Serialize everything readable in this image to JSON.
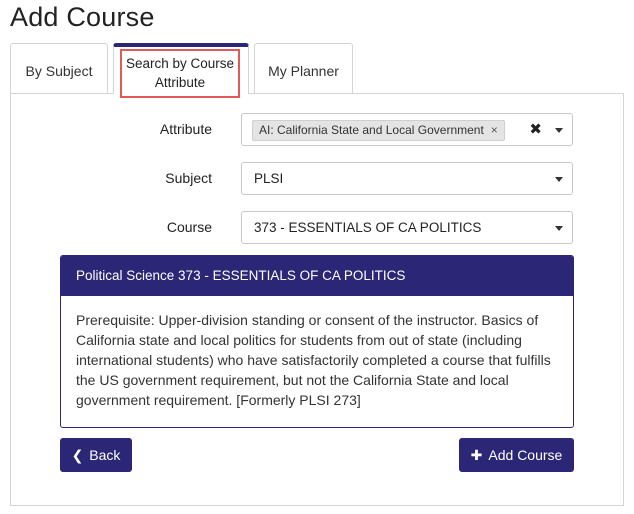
{
  "page": {
    "title": "Add Course"
  },
  "tabs": [
    {
      "label": "By Subject"
    },
    {
      "label": "Search by Course Attribute"
    },
    {
      "label": "My Planner"
    }
  ],
  "form": {
    "attribute": {
      "label": "Attribute",
      "selected_chip": "AI: California State and Local Government",
      "chip_remove": "×",
      "clear": "✖"
    },
    "subject": {
      "label": "Subject",
      "value": "PLSI"
    },
    "course": {
      "label": "Course",
      "value": "373 - ESSENTIALS OF CA POLITICS"
    }
  },
  "course_info": {
    "header": "Political Science 373 - ESSENTIALS OF CA POLITICS",
    "description": "Prerequisite: Upper-division standing or consent of the instructor. Basics of California state and local politics for students from out of state (including international students) who have satisfactorily completed a course that fulfills the US government requirement, but not the California State and local government requirement. [Formerly PLSI 273]"
  },
  "buttons": {
    "back": {
      "icon": "chevron-left-icon",
      "glyph": "❮",
      "label": "Back"
    },
    "add": {
      "icon": "plus-icon",
      "glyph": "✚",
      "label": "Add Course"
    }
  },
  "colors": {
    "accent": "#2b2675",
    "highlight": "#e05a5a"
  }
}
